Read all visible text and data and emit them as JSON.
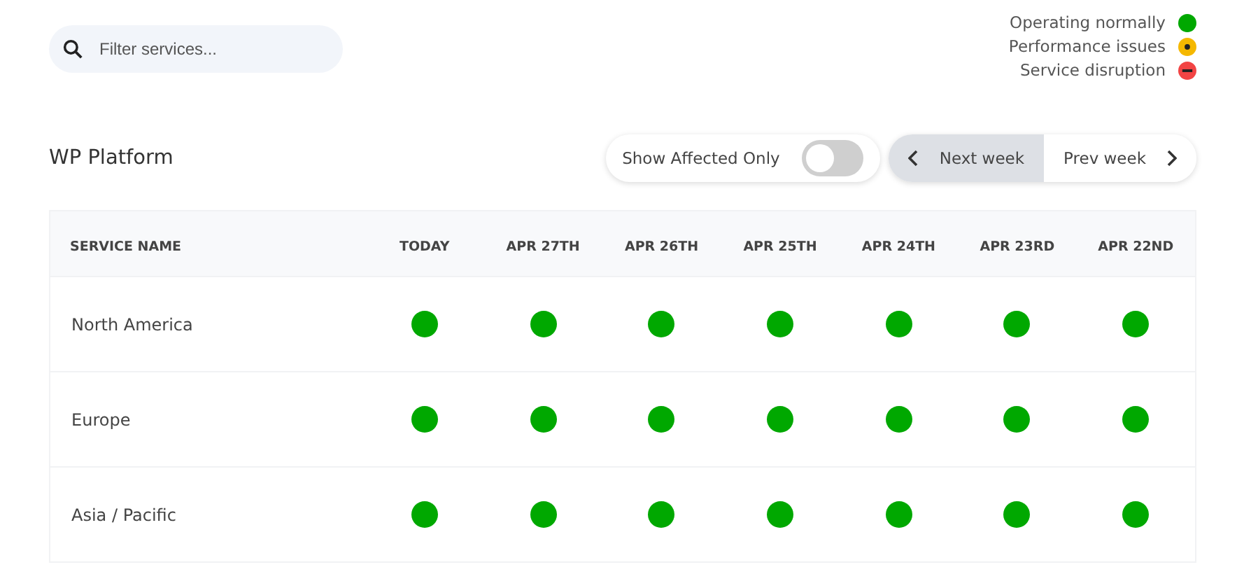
{
  "search": {
    "placeholder": "Filter services..."
  },
  "legend": [
    {
      "label": "Operating normally",
      "kind": "ok"
    },
    {
      "label": "Performance issues",
      "kind": "issue"
    },
    {
      "label": "Service disruption",
      "kind": "down"
    }
  ],
  "section": {
    "title": "WP Platform"
  },
  "filter_toggle": {
    "label": "Show Affected Only",
    "on": false
  },
  "pager": [
    {
      "label": "Next week",
      "kind": "back",
      "selected": true
    },
    {
      "label": "Prev week",
      "kind": "forward",
      "selected": false
    }
  ],
  "table": {
    "columns": [
      "SERVICE NAME",
      "TODAY",
      "APR 27TH",
      "APR 26TH",
      "APR 25TH",
      "APR 24TH",
      "APR 23RD",
      "APR 22ND"
    ],
    "rows": [
      {
        "name": "North America",
        "cells": [
          {
            "kind": "ok"
          },
          {
            "kind": "ok"
          },
          {
            "kind": "ok"
          },
          {
            "kind": "ok"
          },
          {
            "kind": "ok"
          },
          {
            "kind": "ok"
          },
          {
            "kind": "ok"
          }
        ]
      },
      {
        "name": "Europe",
        "cells": [
          {
            "kind": "ok"
          },
          {
            "kind": "ok"
          },
          {
            "kind": "ok"
          },
          {
            "kind": "ok"
          },
          {
            "kind": "ok"
          },
          {
            "kind": "ok"
          },
          {
            "kind": "ok"
          }
        ]
      },
      {
        "name": "Asia / Pacific",
        "cells": [
          {
            "kind": "ok"
          },
          {
            "kind": "ok"
          },
          {
            "kind": "ok"
          },
          {
            "kind": "ok"
          },
          {
            "kind": "ok"
          },
          {
            "kind": "ok"
          },
          {
            "kind": "ok"
          }
        ]
      }
    ]
  }
}
